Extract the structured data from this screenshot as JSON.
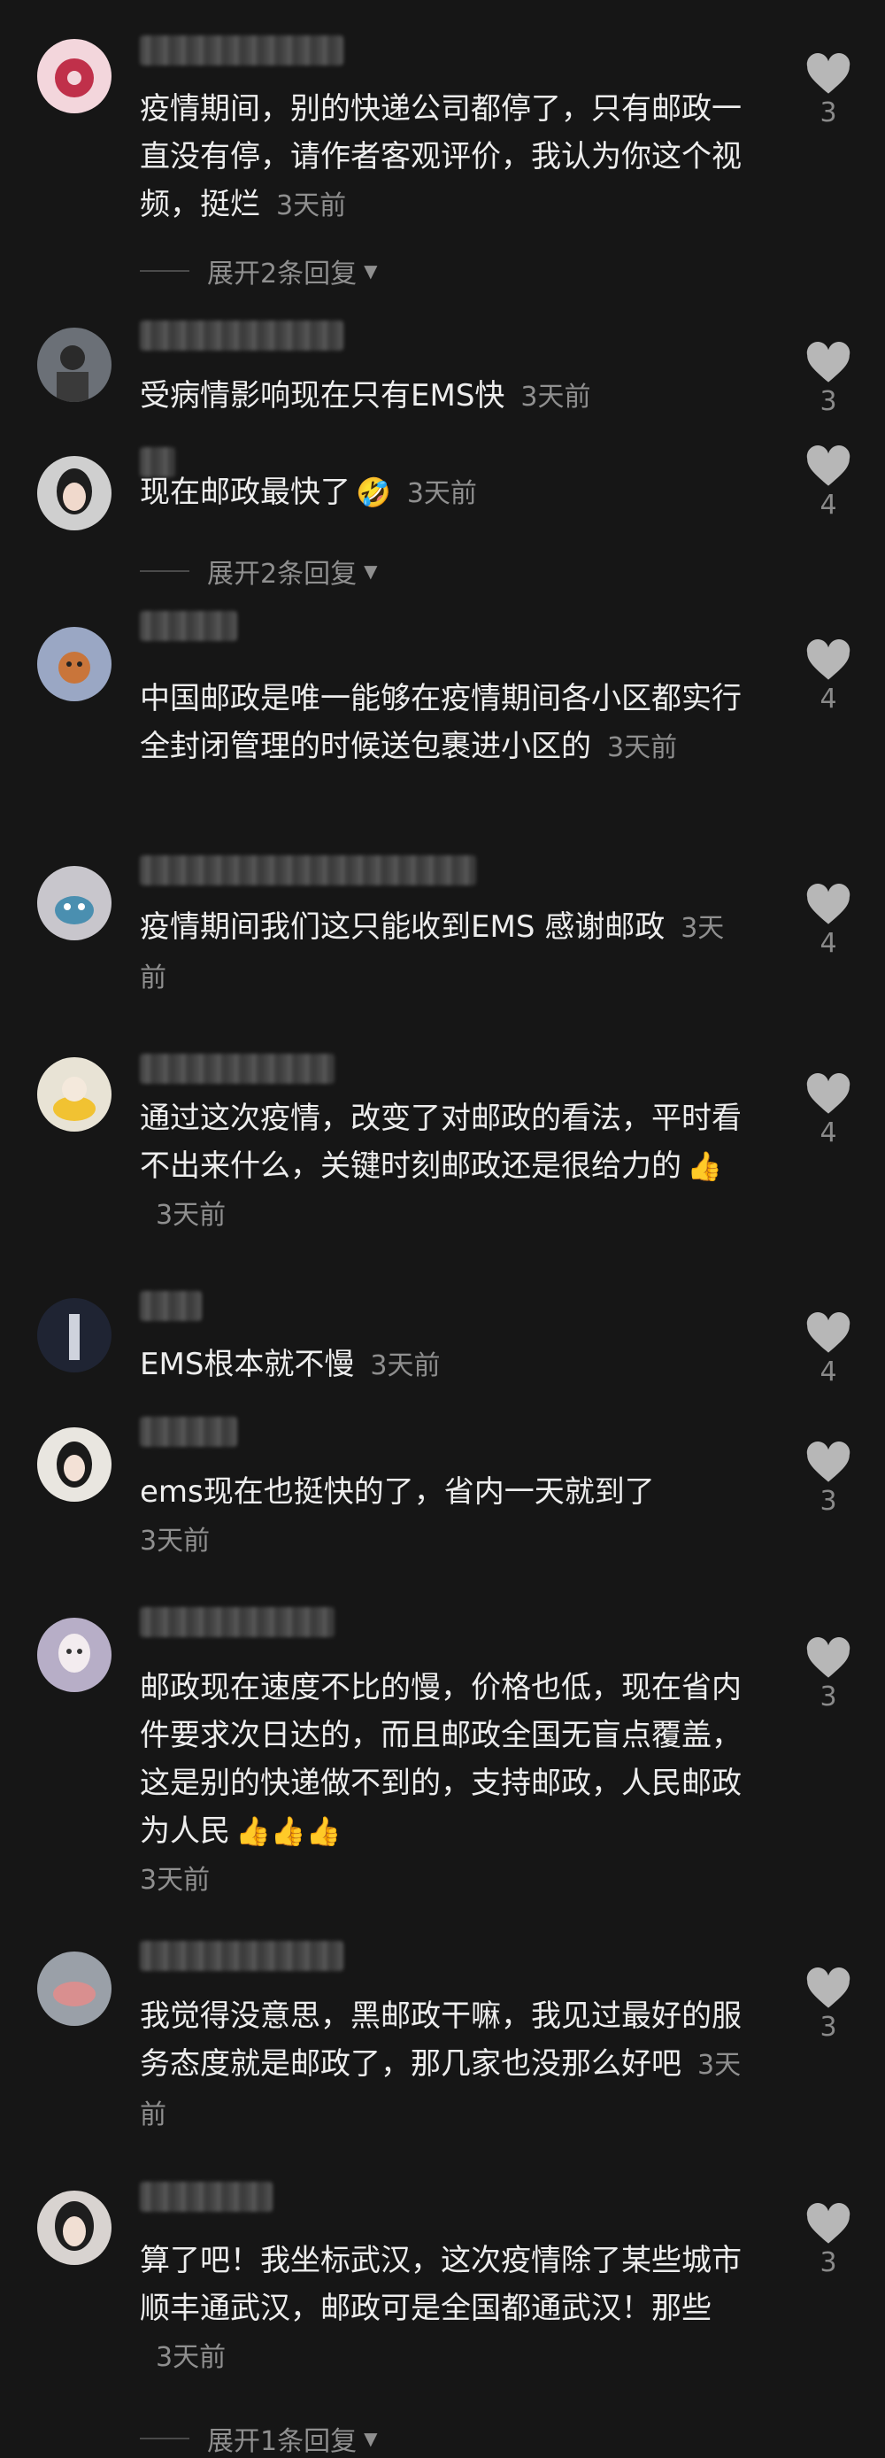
{
  "comments": [
    {
      "text": "疫情期间，别的快递公司都停了，只有邮政一直没有停，请作者客观评价，我认为你这个视频，挺烂",
      "time": "3天前",
      "likes": "3",
      "expand": "展开2条回复"
    },
    {
      "text": "受病情影响现在只有EMS快",
      "time": "3天前",
      "likes": "3"
    },
    {
      "text": "现在邮政最快了",
      "emoji": "🤣",
      "time": "3天前",
      "likes": "4",
      "expand": "展开2条回复"
    },
    {
      "text": "中国邮政是唯一能够在疫情期间各小区都实行全封闭管理的时候送包裹进小区的",
      "time": "3天前",
      "likes": "4"
    },
    {
      "text": "疫情期间我们这只能收到EMS 感谢邮政",
      "time": "3天前",
      "likes": "4"
    },
    {
      "text": "通过这次疫情，改变了对邮政的看法，平时看不出来什么，关键时刻邮政还是很给力的",
      "emoji": "👍",
      "time": "3天前",
      "likes": "4"
    },
    {
      "text": "EMS根本就不慢",
      "time": "3天前",
      "likes": "4"
    },
    {
      "text": "ems现在也挺快的了，省内一天就到了",
      "time": "3天前",
      "likes": "3"
    },
    {
      "text": "邮政现在速度不比的慢，价格也低，现在省内件要求次日达的，而且邮政全国无盲点覆盖，这是别的快递做不到的，支持邮政，人民邮政为人民",
      "emoji": "👍👍👍",
      "time": "3天前",
      "likes": "3"
    },
    {
      "text": "我觉得没意思，黑邮政干嘛，我见过最好的服务态度就是邮政了，那几家也没那么好吧",
      "time": "3天前",
      "likes": "3"
    },
    {
      "text": "算了吧！我坐标武汉，这次疫情除了某些城市顺丰通武汉，邮政可是全国都通武汉！那些",
      "time": "3天前",
      "likes": "3",
      "expand": "展开1条回复"
    }
  ],
  "colors": {
    "background": "#161616",
    "text": "#ededed",
    "muted": "#8f8f8f"
  },
  "icons": {
    "like": "heart-icon",
    "expand": "triangle-down-icon"
  }
}
